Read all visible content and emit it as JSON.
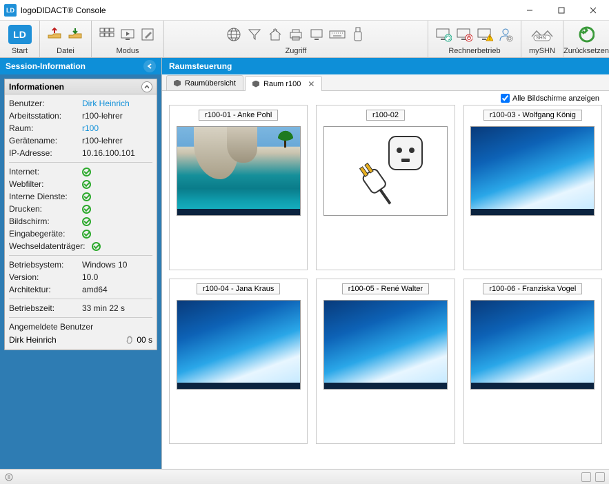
{
  "titlebar": {
    "title": "logoDIDACT® Console",
    "logo": "LD"
  },
  "toolbar": {
    "start": "Start",
    "datei": "Datei",
    "modus": "Modus",
    "zugriff": "Zugriff",
    "rechner": "Rechnerbetrieb",
    "myshn": "mySHN",
    "reset": "Zurücksetzen"
  },
  "session": {
    "header": "Session-Information",
    "info_header": "Informationen",
    "labels": {
      "benutzer": "Benutzer:",
      "arbeitsstation": "Arbeitsstation:",
      "raum": "Raum:",
      "geraetename": "Gerätename:",
      "ip": "IP-Adresse:",
      "internet": "Internet:",
      "webfilter": "Webfilter:",
      "interne": "Interne Dienste:",
      "drucken": "Drucken:",
      "bildschirm": "Bildschirm:",
      "eingabe": "Eingabegeräte:",
      "wechsel": "Wechseldatenträger:",
      "os": "Betriebsystem:",
      "version": "Version:",
      "arch": "Architektur:",
      "uptime": "Betriebszeit:",
      "loggedin": "Angemeldete Benutzer"
    },
    "values": {
      "benutzer": "Dirk Heinrich",
      "arbeitsstation": "r100-lehrer",
      "raum": "r100",
      "geraetename": "r100-lehrer",
      "ip": "10.16.100.101",
      "os": "Windows 10",
      "version": "10.0",
      "arch": "amd64",
      "uptime": "33 min 22 s",
      "user": "Dirk Heinrich",
      "idle": "00 s"
    }
  },
  "content": {
    "header": "Raumsteuerung",
    "tab1": "Raumübersicht",
    "tab2": "Raum r100",
    "show_all": "Alle Bildschirme anzeigen",
    "screens": {
      "s1": "r100-01 - Anke Pohl",
      "s2": "r100-02",
      "s3": "r100-03 - Wolfgang König",
      "s4": "r100-04 - Jana Kraus",
      "s5": "r100-05 - René Walter",
      "s6": "r100-06 - Franziska Vogel"
    }
  }
}
